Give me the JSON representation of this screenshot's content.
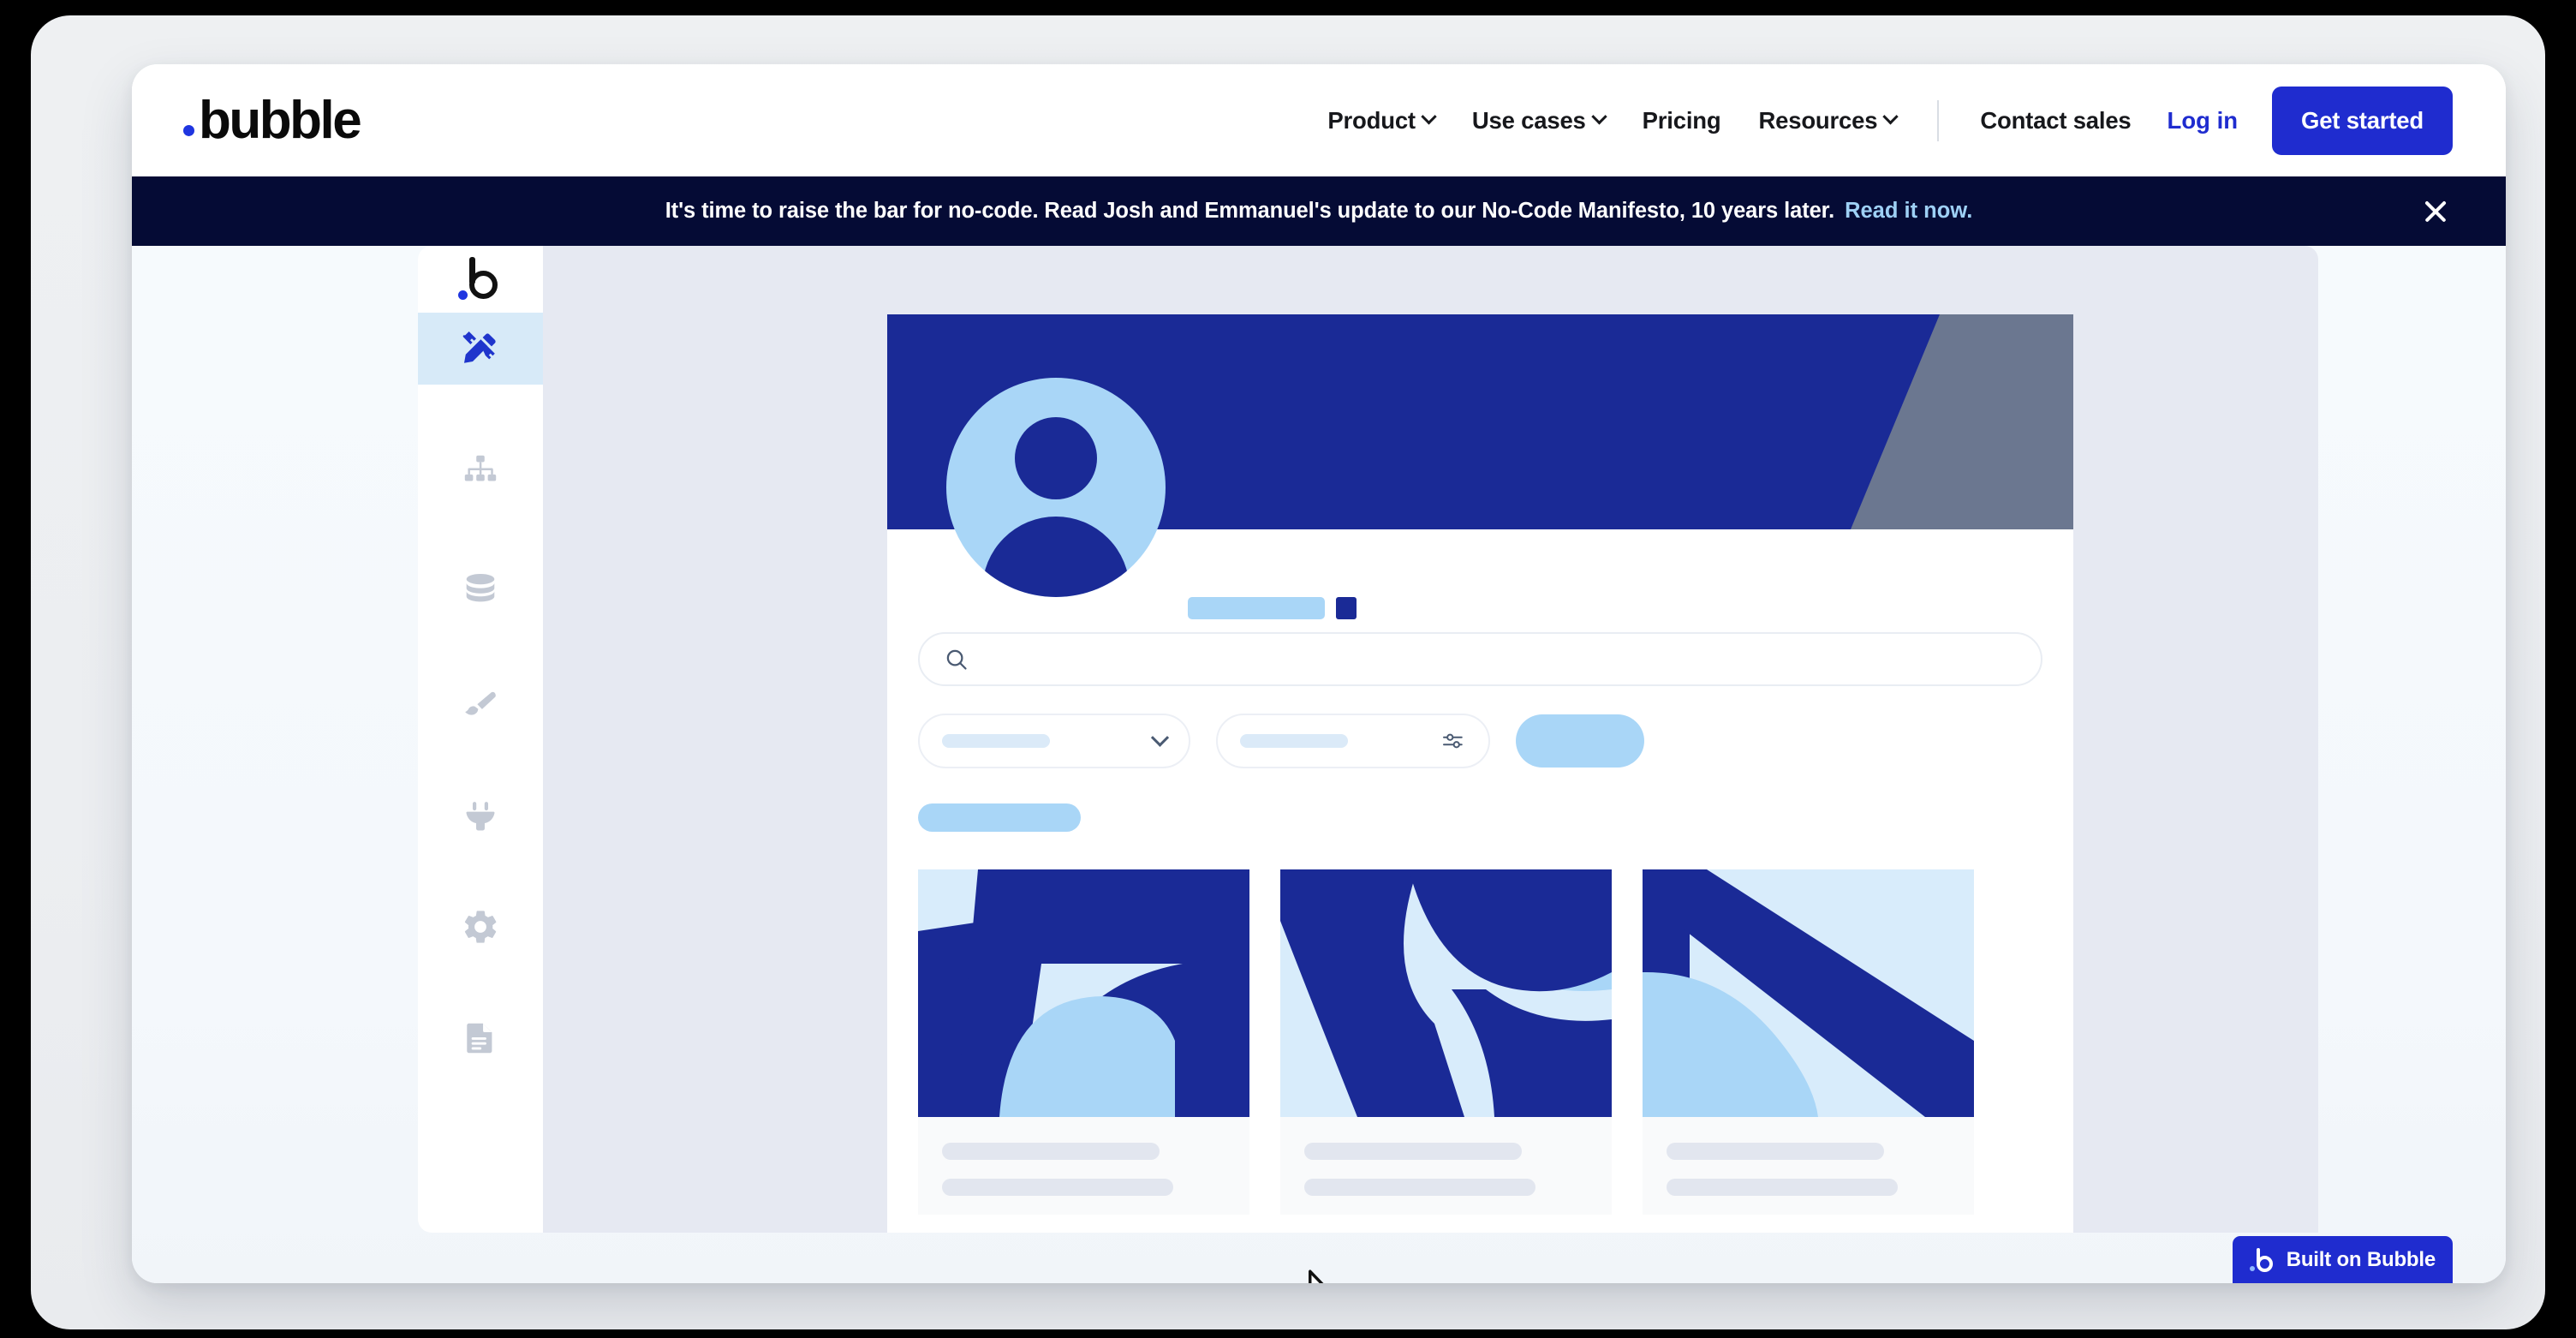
{
  "site": {
    "brand": "bubble",
    "brand_dot_color": "#1f35e0"
  },
  "topnav": {
    "items": [
      {
        "label": "Product",
        "has_dropdown": true,
        "icon": "chevron-down-icon"
      },
      {
        "label": "Use cases",
        "has_dropdown": true,
        "icon": "chevron-down-icon"
      },
      {
        "label": "Pricing",
        "has_dropdown": false,
        "icon": ""
      },
      {
        "label": "Resources",
        "has_dropdown": true,
        "icon": "chevron-down-icon"
      }
    ],
    "contact_sales": "Contact sales",
    "login": "Log in",
    "get_started": "Get started",
    "accent_color": "#1f2ccf"
  },
  "banner": {
    "message": "It's time to raise the bar for no-code. Read Josh and Emmanuel's update to our No-Code Manifesto, 10 years later.",
    "cta": "Read it now.",
    "background_color": "#050b35",
    "cta_color": "#9ed0f5",
    "close_icon": "close-icon"
  },
  "app_preview": {
    "sidebar": {
      "logo_icon": "bubble-logo-icon",
      "items": [
        {
          "icon": "design-pencil-ruler-icon",
          "name": "design",
          "active": true
        },
        {
          "icon": "workflow-sitemap-icon",
          "name": "workflow",
          "active": false
        },
        {
          "icon": "database-icon",
          "name": "data",
          "active": false
        },
        {
          "icon": "paintbrush-icon",
          "name": "styles",
          "active": false
        },
        {
          "icon": "plugin-icon",
          "name": "plugins",
          "active": false
        },
        {
          "icon": "gear-icon",
          "name": "settings",
          "active": false
        },
        {
          "icon": "file-document-icon",
          "name": "logs",
          "active": false
        }
      ],
      "active_background": "#d7eaf8",
      "active_color": "#1f35cc"
    },
    "canvas_background": "#e6e9f2",
    "hero": {
      "background_color": "#1a2a96",
      "wedge_color": "#6b7790",
      "avatar_icon": "user-avatar-icon",
      "avatar_bg": "#a9d6f7"
    },
    "search": {
      "icon": "search-icon",
      "value": "",
      "placeholder": ""
    },
    "filters": {
      "select_icon": "chevron-down-icon",
      "tune_icon": "sliders-tune-icon",
      "apply_button_color": "#a9d6f7"
    },
    "cards": [
      {
        "name": "card-1"
      },
      {
        "name": "card-2"
      },
      {
        "name": "card-3"
      }
    ],
    "cursor_icon": "mouse-pointer-icon"
  },
  "built_badge": {
    "label": "Built on Bubble",
    "icon": "bubble-logo-icon",
    "background_color": "#1f2ccf"
  }
}
